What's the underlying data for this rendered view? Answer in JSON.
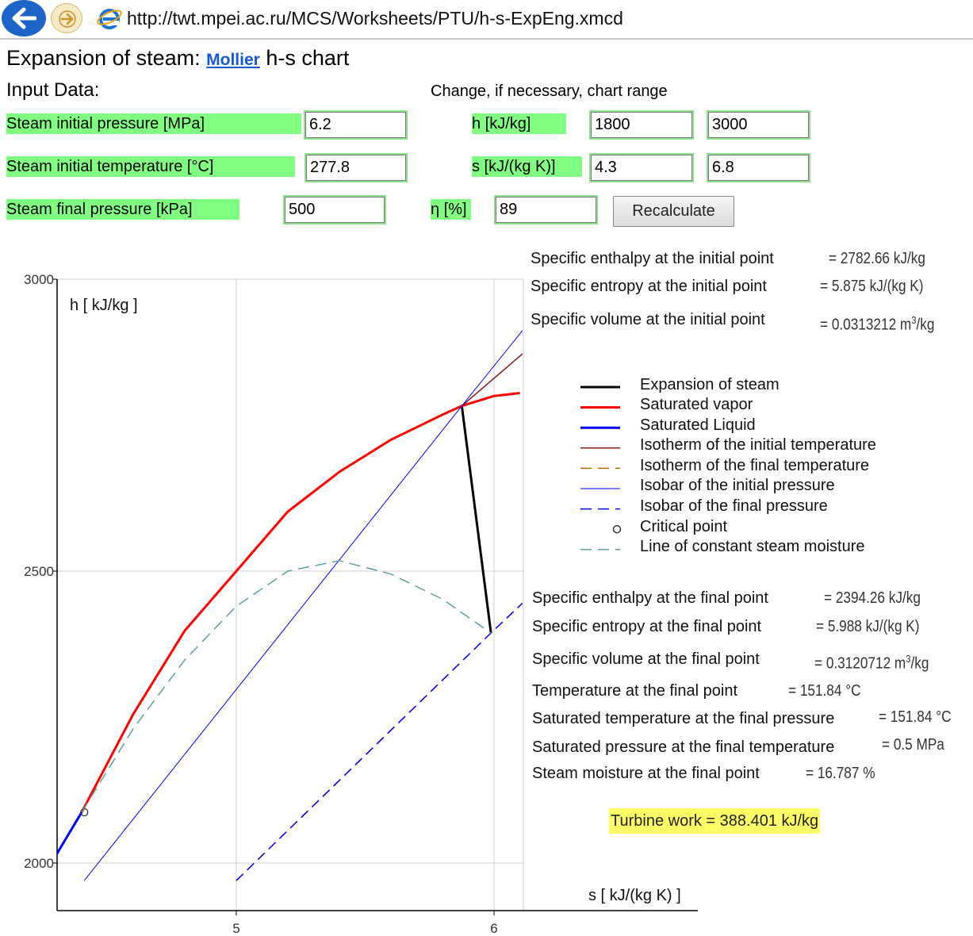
{
  "browser": {
    "url": "http://twt.mpei.ac.ru/MCS/Worksheets/PTU/h-s-ExpEng.xmcd"
  },
  "page": {
    "title_prefix": "Expansion of steam:",
    "title_link": "Mollier",
    "title_suffix": "h-s chart",
    "input_heading": "Input Data:",
    "range_heading": "Change, if necessary, chart range"
  },
  "inputs": {
    "initial_pressure": {
      "label": "Steam initial pressure [MPa]",
      "value": "6.2"
    },
    "initial_temperature": {
      "label": "Steam initial temperature [°C]",
      "value": "277.8"
    },
    "final_pressure": {
      "label": "Steam final pressure [kPa]",
      "value": "500"
    },
    "h_range": {
      "label": "h [kJ/kg]",
      "min": "1800",
      "max": "3000"
    },
    "s_range": {
      "label": "s [kJ/(kg K)]",
      "min": "4.3",
      "max": "6.8"
    },
    "efficiency": {
      "label": "η [%]",
      "value": "89"
    },
    "recalculate_label": "Recalculate"
  },
  "results_initial": [
    {
      "label": "Specific enthalpy at the initial point",
      "value": "= 2782.66 kJ/kg"
    },
    {
      "label": "Specific entropy at the initial point",
      "value": "= 5.875 kJ/(kg K)"
    },
    {
      "label": "Specific volume at the initial point",
      "value": "= 0.0313212 m",
      "unit_sup": "3",
      "unit_after": "/kg"
    }
  ],
  "results_final": [
    {
      "label": "Specific enthalpy at the final point",
      "value": "= 2394.26 kJ/kg"
    },
    {
      "label": "Specific entropy at the final point",
      "value": "= 5.988 kJ/(kg K)"
    },
    {
      "label": "Specific volume at the final point",
      "value": "= 0.3120712 m",
      "unit_sup": "3",
      "unit_after": "/kg"
    },
    {
      "label": "Temperature at the final point",
      "value": "= 151.84 °C"
    },
    {
      "label": "Saturated temperature at the final pressure",
      "value": "= 151.84 °C"
    },
    {
      "label": "Saturated pressure at the final temperature",
      "value": "= 0.5 MPa"
    },
    {
      "label": "Steam moisture at the final point",
      "value": "= 16.787 %"
    }
  ],
  "turbine_work": "Turbine work = 388.401 kJ/kg",
  "legend": [
    {
      "label": "Expansion of steam",
      "color": "#000000",
      "style": "solid",
      "width": 3
    },
    {
      "label": "Saturated vapor",
      "color": "#ff0000",
      "style": "solid",
      "width": 3
    },
    {
      "label": "Saturated Liquid",
      "color": "#0000ff",
      "style": "solid",
      "width": 3
    },
    {
      "label": "Isotherm of the initial temperature",
      "color": "#8b1a1a",
      "style": "solid",
      "width": 1.5
    },
    {
      "label": "Isotherm of the final temperature",
      "color": "#b36b00",
      "style": "dash",
      "width": 1.5
    },
    {
      "label": "Isobar of the initial pressure",
      "color": "#0000ff",
      "style": "solid",
      "width": 1
    },
    {
      "label": "Isobar of the final pressure",
      "color": "#0000ff",
      "style": "dash",
      "width": 1.5
    },
    {
      "label": "Critical point",
      "color": "#000000",
      "style": "circle",
      "width": 1
    },
    {
      "label": "Line of constant steam moisture",
      "color": "#5f9ea0",
      "style": "dash",
      "width": 1.5
    }
  ],
  "chart_data": {
    "type": "line",
    "xlabel": "s [ kJ/(kg K) ]",
    "ylabel": "h [ kJ/kg ]",
    "xlim": [
      4.3,
      6.8
    ],
    "ylim": [
      1950,
      3000
    ],
    "xticks": [
      5,
      6
    ],
    "yticks": [
      2000,
      2500,
      3000
    ],
    "grid": true,
    "series": [
      {
        "name": "Expansion of steam",
        "x": [
          5.875,
          5.988
        ],
        "y": [
          2782.66,
          2394.26
        ]
      },
      {
        "name": "Saturated vapor",
        "x": [
          4.4,
          4.6,
          4.8,
          5.0,
          5.2,
          5.4,
          5.6,
          5.8,
          5.875,
          6.0,
          6.1
        ],
        "y": [
          2087,
          2255,
          2398,
          2500,
          2602,
          2670,
          2725,
          2768,
          2783,
          2800,
          2805
        ]
      },
      {
        "name": "Saturated Liquid",
        "x": [
          4.3,
          4.4
        ],
        "y": [
          2013,
          2087
        ]
      },
      {
        "name": "Isotherm of the initial temperature",
        "x": [
          5.875,
          6.11
        ],
        "y": [
          2783,
          2872
        ]
      },
      {
        "name": "Isotherm of the final temperature",
        "x": [
          5.0,
          5.988,
          6.11
        ],
        "y": [
          1970,
          2394,
          2445
        ]
      },
      {
        "name": "Isobar of the initial pressure",
        "x": [
          4.41,
          5.875,
          6.11
        ],
        "y": [
          1970,
          2783,
          2912
        ]
      },
      {
        "name": "Isobar of the final pressure",
        "x": [
          5.0,
          5.988,
          6.11
        ],
        "y": [
          1970,
          2394,
          2445
        ]
      },
      {
        "name": "Critical point",
        "x": [
          4.41
        ],
        "y": [
          2087
        ]
      },
      {
        "name": "Line of constant steam moisture",
        "x": [
          4.4,
          4.6,
          4.8,
          5.0,
          5.2,
          5.4,
          5.6,
          5.8,
          5.988
        ],
        "y": [
          2087,
          2230,
          2348,
          2440,
          2500,
          2518,
          2495,
          2452,
          2394
        ]
      }
    ]
  }
}
